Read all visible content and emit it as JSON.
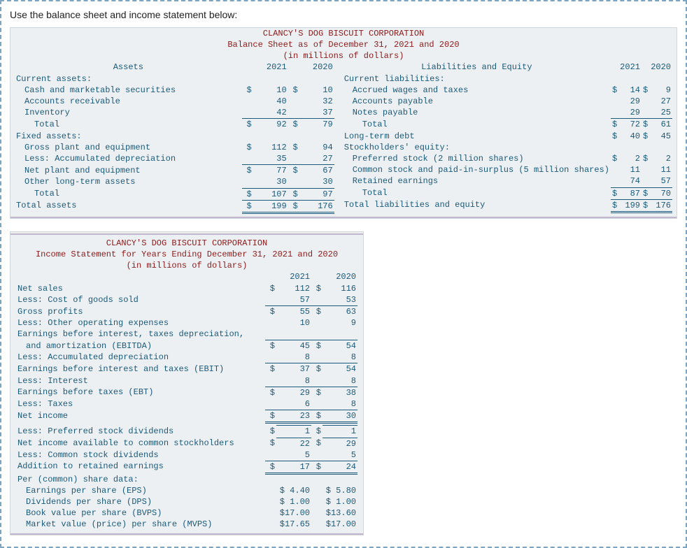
{
  "intro": "Use the balance sheet and income statement below:",
  "balance": {
    "title1": "CLANCY'S DOG BISCUIT CORPORATION",
    "title2": "Balance Sheet as of December 31, 2021 and 2020",
    "title3": "(in millions of dollars)",
    "assets_header": "Assets",
    "liab_header": "Liabilities and Equity",
    "y21": "2021",
    "y20": "2020",
    "assets": {
      "current_label": "Current assets:",
      "cash_label": "Cash and marketable securities",
      "cash_21": "10",
      "cash_20": "10",
      "ar_label": "Accounts receivable",
      "ar_21": "40",
      "ar_20": "32",
      "inv_label": "Inventory",
      "inv_21": "42",
      "inv_20": "37",
      "cur_total_label": "Total",
      "cur_total_21": "92",
      "cur_total_20": "79",
      "fixed_label": "Fixed assets:",
      "gpe_label": "Gross plant and equipment",
      "gpe_21": "112",
      "gpe_20": "94",
      "ad_label": "Less: Accumulated depreciation",
      "ad_21": "35",
      "ad_20": "27",
      "npe_label": "Net plant and equipment",
      "npe_21": "77",
      "npe_20": "67",
      "olta_label": "Other long-term assets",
      "olta_21": "30",
      "olta_20": "30",
      "fix_total_label": "Total",
      "fix_total_21": "107",
      "fix_total_20": "97",
      "ta_label": "Total assets",
      "ta_21": "199",
      "ta_20": "176"
    },
    "liab": {
      "current_label": "Current liabilities:",
      "awt_label": "Accrued wages and taxes",
      "awt_21": "14",
      "awt_20": "9",
      "ap_label": "Accounts payable",
      "ap_21": "29",
      "ap_20": "27",
      "np_label": "Notes payable",
      "np_21": "29",
      "np_20": "25",
      "cur_total_label": "Total",
      "cur_total_21": "72",
      "cur_total_20": "61",
      "ltd_label": "Long-term debt",
      "ltd_21": "40",
      "ltd_20": "45",
      "se_label": "Stockholders' equity:",
      "ps_label": "Preferred stock (2 million shares)",
      "ps_21": "2",
      "ps_20": "2",
      "cs_label": "Common stock and paid-in-surplus (5 million shares)",
      "cs_21": "11",
      "cs_20": "11",
      "re_label": "Retained earnings",
      "re_21": "74",
      "re_20": "57",
      "se_total_label": "Total",
      "se_total_21": "87",
      "se_total_20": "70",
      "tle_label": "Total liabilities and equity",
      "tle_21": "199",
      "tle_20": "176"
    }
  },
  "income": {
    "title1": "CLANCY'S DOG BISCUIT CORPORATION",
    "title2": "Income Statement for Years Ending December 31, 2021 and 2020",
    "title3": "(in millions of dollars)",
    "y21": "2021",
    "y20": "2020",
    "net_sales": "Net sales",
    "net_sales_21": "112",
    "net_sales_20": "116",
    "cogs": "Less: Cost of goods sold",
    "cogs_21": "57",
    "cogs_20": "53",
    "gp": "Gross profits",
    "gp_21": "55",
    "gp_20": "63",
    "ooe": "Less: Other operating expenses",
    "ooe_21": "10",
    "ooe_20": "9",
    "ebitda1": "Earnings before interest, taxes depreciation,",
    "ebitda2": "and amortization (EBITDA)",
    "ebitda_21": "45",
    "ebitda_20": "54",
    "dep": "Less: Accumulated depreciation",
    "dep_21": "8",
    "dep_20": "8",
    "ebit": "Earnings before interest and taxes (EBIT)",
    "ebit_21": "37",
    "ebit_20": "54",
    "int": "Less: Interest",
    "int_21": "8",
    "int_20": "8",
    "ebt": "Earnings before taxes (EBT)",
    "ebt_21": "29",
    "ebt_20": "38",
    "tax": "Less: Taxes",
    "tax_21": "6",
    "tax_20": "8",
    "ni": "Net income",
    "ni_21": "23",
    "ni_20": "30",
    "pd": "Less: Preferred stock dividends",
    "pd_21": "1",
    "pd_20": "1",
    "niac": "Net income available to common stockholders",
    "niac_21": "22",
    "niac_20": "29",
    "cd": "Less: Common stock dividends",
    "cd_21": "5",
    "cd_20": "5",
    "are": "Addition to retained earnings",
    "are_21": "17",
    "are_20": "24",
    "psd": "Per (common) share data:",
    "eps_label": "Earnings per share (EPS)",
    "eps_21": "$ 4.40",
    "eps_20": "$ 5.80",
    "dps_label": "Dividends per share (DPS)",
    "dps_21": "$ 1.00",
    "dps_20": "$ 1.00",
    "bvps_label": "Book value per share (BVPS)",
    "bvps_21": "$17.00",
    "bvps_20": "$13.60",
    "mvps_label": "Market value (price) per share (MVPS)",
    "mvps_21": "$17.65",
    "mvps_20": "$17.00"
  },
  "dollar": "$"
}
